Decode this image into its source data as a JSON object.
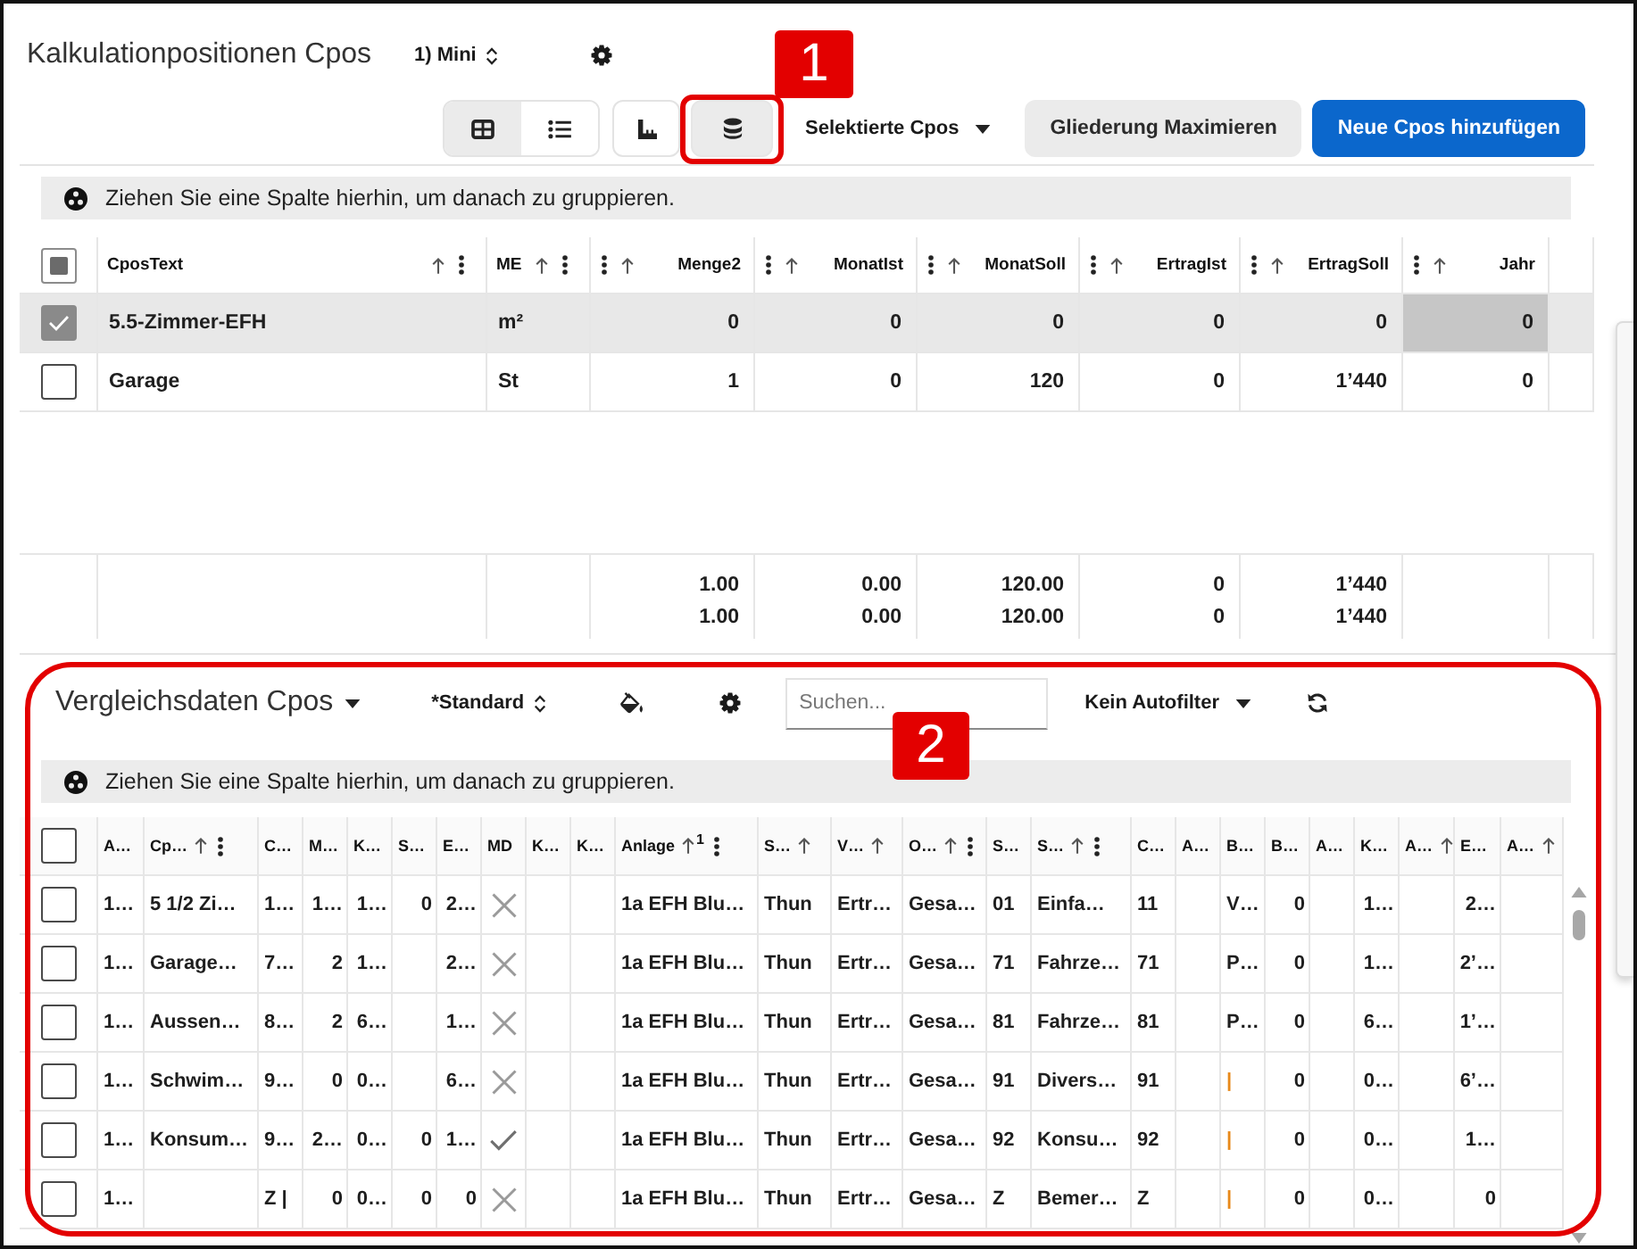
{
  "upper": {
    "title": "Kalkulationpositionen Cpos",
    "layout_select": {
      "value": "1) Mini"
    },
    "view_toggle": [
      {
        "kind": "table",
        "selected": true
      },
      {
        "kind": "list",
        "selected": false
      }
    ],
    "tool_buttons": [
      {
        "kind": "ruler",
        "selected": false
      },
      {
        "kind": "database",
        "selected": true,
        "annotation": "1"
      }
    ],
    "selection_dropdown": {
      "label": "Selektierte Cpos"
    },
    "buttons": [
      {
        "label": "Gliederung Maximieren",
        "kind": "secondary"
      },
      {
        "label": "Neue Cpos hinzufügen",
        "kind": "primary"
      }
    ],
    "group_panel": {
      "text": "Ziehen Sie eine Spalte hierhin, um danach zu gruppieren."
    },
    "grid": {
      "select_all": {
        "indeterminate": true
      },
      "columns": [
        {
          "label": "CposText",
          "kind": "text",
          "sortable": true,
          "menu": true
        },
        {
          "label": "ME",
          "kind": "text",
          "sortable": true,
          "menu": true
        },
        {
          "label": "Menge2",
          "kind": "number",
          "sortable": true,
          "menu": true
        },
        {
          "label": "MonatIst",
          "kind": "number",
          "sortable": true,
          "menu": true
        },
        {
          "label": "MonatSoll",
          "kind": "number",
          "sortable": true,
          "menu": true
        },
        {
          "label": "ErtragIst",
          "kind": "number",
          "sortable": true,
          "menu": true
        },
        {
          "label": "ErtragSoll",
          "kind": "number",
          "sortable": true,
          "menu": true
        },
        {
          "label": "Jahr",
          "kind": "number",
          "sortable": true,
          "menu": true
        }
      ],
      "rows": [
        {
          "selected": true,
          "cells": [
            {
              "text": "5.5-Zimmer-EFH",
              "focused": false
            },
            {
              "text": "m²",
              "focused": false
            },
            {
              "text": "0",
              "focused": false
            },
            {
              "text": "0",
              "focused": false
            },
            {
              "text": "0",
              "focused": false
            },
            {
              "text": "0",
              "focused": false
            },
            {
              "text": "0",
              "focused": false
            },
            {
              "text": "0",
              "focused": true
            }
          ]
        },
        {
          "selected": false,
          "cells": [
            {
              "text": "Garage",
              "focused": false
            },
            {
              "text": "St",
              "focused": false
            },
            {
              "text": "1",
              "focused": false
            },
            {
              "text": "0",
              "focused": false
            },
            {
              "text": "120",
              "focused": false
            },
            {
              "text": "0",
              "focused": false
            },
            {
              "text": "1’440",
              "focused": false
            },
            {
              "text": "0",
              "focused": false
            }
          ]
        }
      ],
      "totals": [
        [
          "1.00",
          "0.00",
          "120.00",
          "0",
          "1’440"
        ],
        [
          "1.00",
          "0.00",
          "120.00",
          "0",
          "1’440"
        ]
      ]
    }
  },
  "lower": {
    "title": "Vergleichsdaten Cpos",
    "layout_select": {
      "value": "*Standard"
    },
    "search": {
      "placeholder": "Suchen..."
    },
    "filter_dropdown": {
      "label": "Kein Autofilter"
    },
    "annotation": "2",
    "group_panel": {
      "text": "Ziehen Sie eine Spalte hierhin, um danach zu gruppieren."
    },
    "grid": {
      "select_all": {
        "checked": false
      },
      "columns": [
        {
          "label": "A…",
          "kind": "text",
          "sortable": false,
          "menu": false
        },
        {
          "label": "Cp…",
          "kind": "text",
          "sortable": true,
          "menu": true
        },
        {
          "label": "C…",
          "kind": "text",
          "sortable": false,
          "menu": false
        },
        {
          "label": "M…",
          "kind": "number",
          "sortable": false,
          "menu": false
        },
        {
          "label": "K…",
          "kind": "number",
          "sortable": false,
          "menu": false
        },
        {
          "label": "S…",
          "kind": "number",
          "sortable": false,
          "menu": false
        },
        {
          "label": "E…",
          "kind": "number",
          "sortable": false,
          "menu": false
        },
        {
          "label": "MD",
          "kind": "flag",
          "sortable": false,
          "menu": false
        },
        {
          "label": "K…",
          "kind": "text",
          "sortable": false,
          "menu": false
        },
        {
          "label": "K…",
          "kind": "text",
          "sortable": false,
          "menu": false
        },
        {
          "label": "Anlage",
          "kind": "text",
          "sortable": true,
          "sort_order": "1",
          "menu": true
        },
        {
          "label": "S…",
          "kind": "text",
          "sortable": true,
          "menu": false
        },
        {
          "label": "V…",
          "kind": "text",
          "sortable": true,
          "menu": false
        },
        {
          "label": "O…",
          "kind": "text",
          "sortable": true,
          "menu": true
        },
        {
          "label": "S…",
          "kind": "text",
          "sortable": false,
          "menu": false
        },
        {
          "label": "S…",
          "kind": "text",
          "sortable": true,
          "menu": true
        },
        {
          "label": "C…",
          "kind": "text",
          "sortable": false,
          "menu": false
        },
        {
          "label": "A…",
          "kind": "text",
          "sortable": false,
          "menu": false
        },
        {
          "label": "B…",
          "kind": "text",
          "sortable": false,
          "menu": false
        },
        {
          "label": "B…",
          "kind": "number",
          "sortable": false,
          "menu": false
        },
        {
          "label": "A…",
          "kind": "text",
          "sortable": false,
          "menu": false
        },
        {
          "label": "K…",
          "kind": "number",
          "sortable": false,
          "menu": false
        },
        {
          "label": "A…",
          "kind": "text",
          "sortable": true,
          "menu": false
        },
        {
          "label": "E…",
          "kind": "number",
          "sortable": false,
          "menu": false
        },
        {
          "label": "A…",
          "kind": "text",
          "sortable": true,
          "menu": false
        }
      ],
      "rows": [
        {
          "selected": false,
          "md_checked": false,
          "cells": [
            "1…",
            "5 1/2 Zi…",
            "1…",
            "1…",
            "1…",
            "0",
            "2…",
            null,
            null,
            null,
            "1a EFH Blu…",
            "Thun",
            "Ertr…",
            "Gesa…",
            "01",
            "Einfa…",
            "11",
            null,
            "V…",
            "0",
            null,
            "1…",
            null,
            "2…",
            null
          ]
        },
        {
          "selected": false,
          "md_checked": false,
          "cells": [
            "1…",
            "Garage…",
            "7…",
            "2",
            "1…",
            null,
            "2…",
            null,
            null,
            null,
            "1a EFH Blu…",
            "Thun",
            "Ertr…",
            "Gesa…",
            "71",
            "Fahrze…",
            "71",
            null,
            "P…",
            "0",
            null,
            "1…",
            null,
            "2’…",
            null
          ]
        },
        {
          "selected": false,
          "md_checked": false,
          "cells": [
            "1…",
            "Aussen…",
            "8…",
            "2",
            "6…",
            null,
            "1…",
            null,
            null,
            null,
            "1a EFH Blu…",
            "Thun",
            "Ertr…",
            "Gesa…",
            "81",
            "Fahrze…",
            "81",
            null,
            "P…",
            "0",
            null,
            "6…",
            null,
            "1’…",
            null
          ]
        },
        {
          "selected": false,
          "md_checked": false,
          "cells": [
            "1…",
            "Schwim…",
            "9…",
            "0",
            "0…",
            null,
            "6…",
            null,
            null,
            null,
            "1a EFH Blu…",
            "Thun",
            "Ertr…",
            "Gesa…",
            "91",
            "Divers…",
            "91",
            null,
            {
              "text": "|",
              "color": "#e8891a"
            },
            "0",
            null,
            "0…",
            null,
            "6’…",
            null
          ]
        },
        {
          "selected": false,
          "md_checked": true,
          "cells": [
            "1…",
            "Konsum…",
            "9…",
            "2…",
            "0…",
            "0",
            "1…",
            null,
            null,
            null,
            "1a EFH Blu…",
            "Thun",
            "Ertr…",
            "Gesa…",
            "92",
            "Konsu…",
            "92",
            null,
            {
              "text": "|",
              "color": "#e8891a"
            },
            "0",
            null,
            "0…",
            null,
            "1…",
            null
          ]
        },
        {
          "selected": false,
          "md_checked": false,
          "cells": [
            "1…",
            null,
            "Z |",
            "0",
            "0…",
            "0",
            "0",
            null,
            null,
            null,
            "1a EFH Blu…",
            "Thun",
            "Ertr…",
            "Gesa…",
            "Z",
            "Bemer…",
            "Z",
            null,
            {
              "text": "|",
              "color": "#e8891a"
            },
            "0",
            null,
            "0…",
            null,
            "0",
            null
          ]
        }
      ]
    }
  }
}
